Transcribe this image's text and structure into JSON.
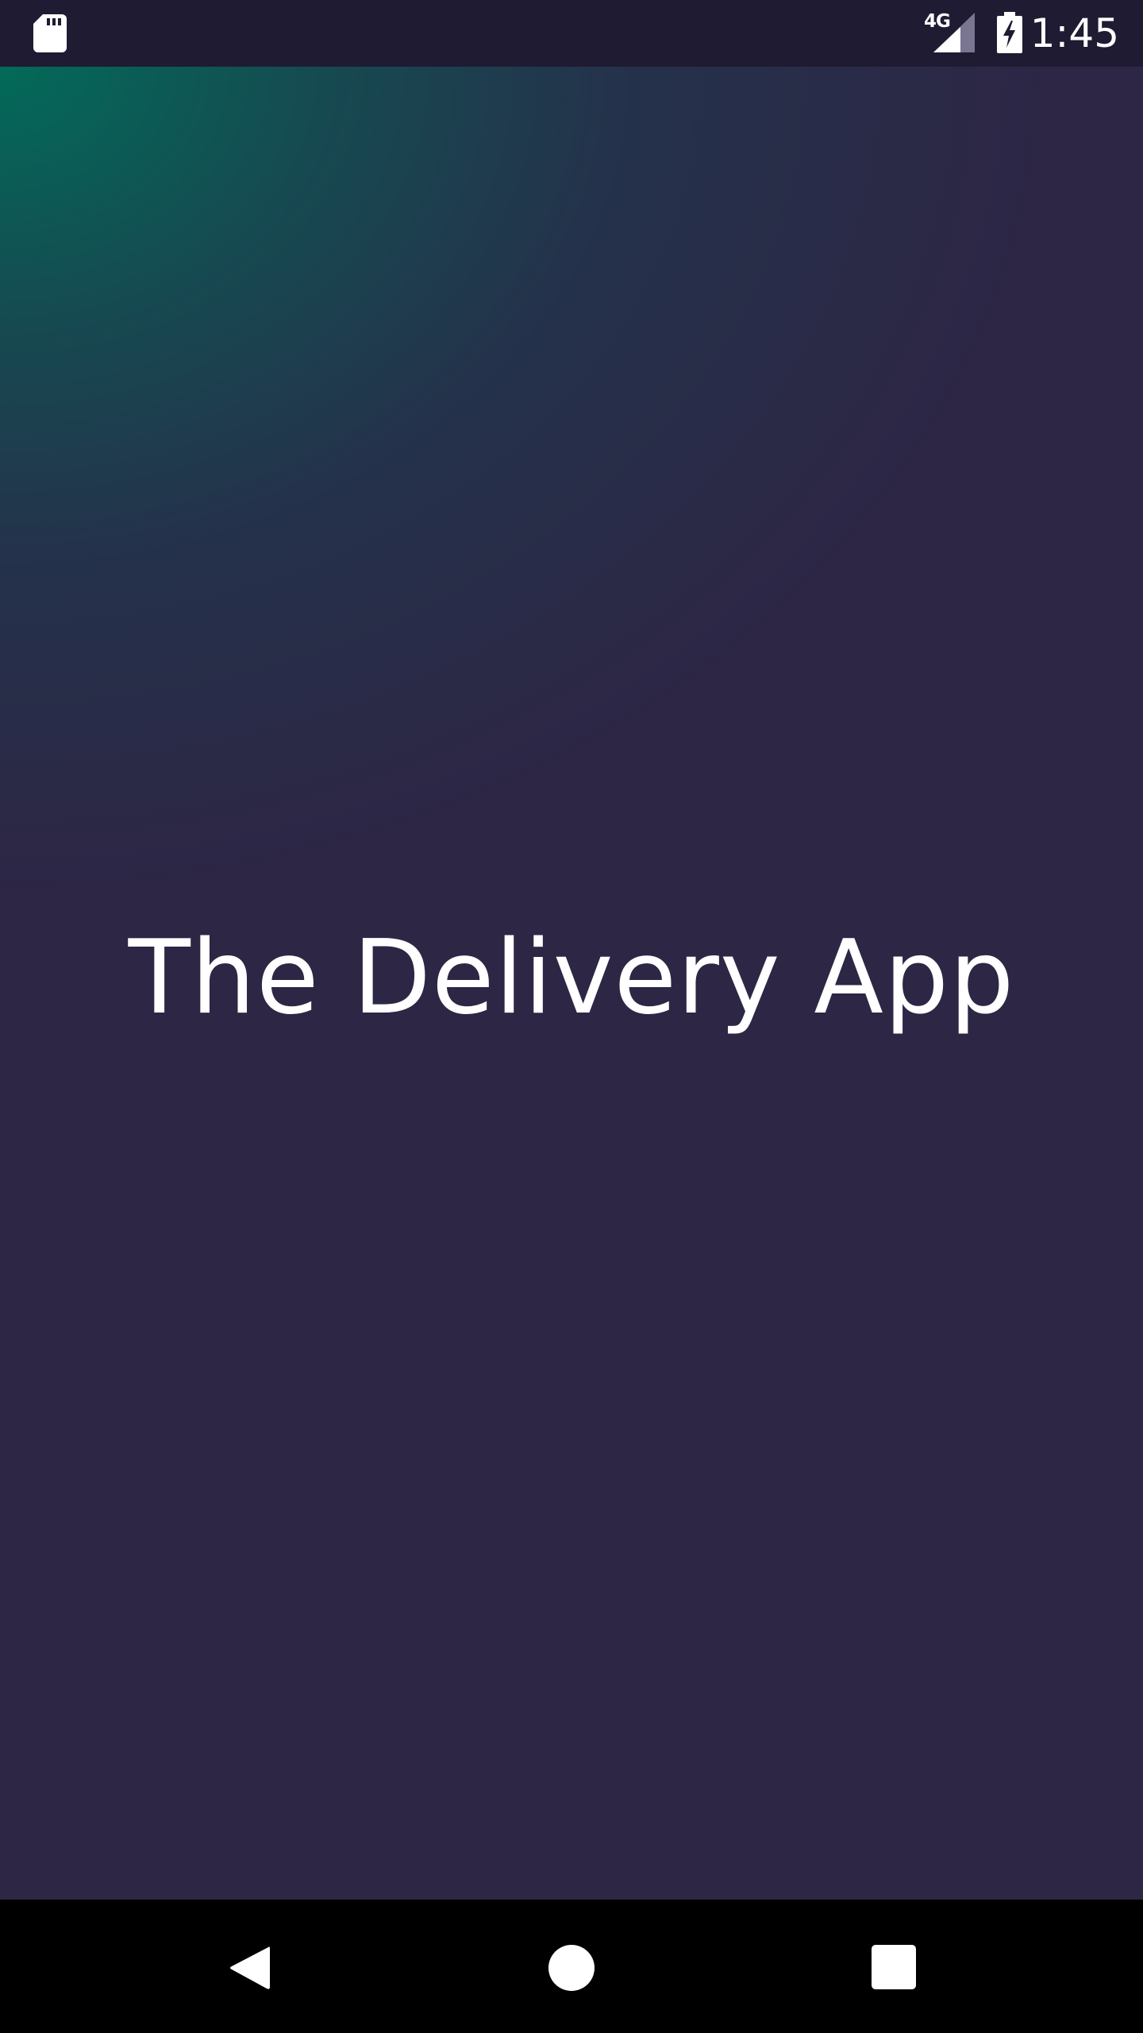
{
  "status_bar": {
    "time": "1:45",
    "network": "4G",
    "icons": [
      "sd-card-icon",
      "signal-icon",
      "battery-charging-icon"
    ]
  },
  "splash": {
    "title": "The Delivery App"
  },
  "nav_bar": {
    "icons": [
      "back-icon",
      "home-icon",
      "recents-icon"
    ]
  },
  "colors": {
    "status_bar_bg": "#1f1b33",
    "background": "#2d2645",
    "gradient_accent": "#006e5a",
    "text": "#ffffff",
    "nav_bar_bg": "#000000"
  }
}
